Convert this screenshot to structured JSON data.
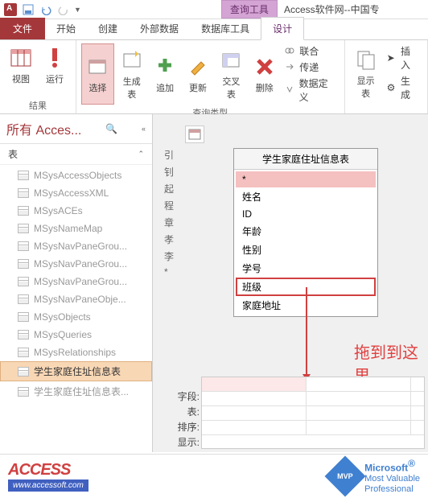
{
  "titlebar": {
    "context_tab": "查询工具",
    "app_title": "Access软件网--中国专"
  },
  "tabs": {
    "file": "文件",
    "start": "开始",
    "create": "创建",
    "external": "外部数据",
    "dbtools": "数据库工具",
    "design": "设计"
  },
  "ribbon": {
    "view": "视图",
    "run": "运行",
    "select": "选择",
    "maketable": "生成表",
    "append": "追加",
    "update": "更新",
    "crosstab": "交叉表",
    "delete": "删除",
    "union": "联合",
    "passthrough": "传递",
    "datadef": "数据定义",
    "showtable": "显示表",
    "insert": "插入",
    "buildrow": "生成",
    "grp_results": "结果",
    "grp_querytype": "查询类型"
  },
  "nav": {
    "title": "所有 Acces...",
    "section": "表",
    "items": [
      "MSysAccessObjects",
      "MSysAccessXML",
      "MSysACEs",
      "MSysNameMap",
      "MSysNavPaneGrou...",
      "MSysNavPaneGrou...",
      "MSysNavPaneGrou...",
      "MSysNavPaneObje...",
      "MSysObjects",
      "MSysQueries",
      "MSysRelationships",
      "学生家庭住址信息表",
      "学生家庭住址信息表..."
    ]
  },
  "fieldbox": {
    "title": "学生家庭住址信息表",
    "fields": [
      "*",
      "姓名",
      "ID",
      "年龄",
      "性别",
      "学号",
      "班级",
      "家庭地址"
    ]
  },
  "sidecol": [
    "引",
    "钊",
    "起",
    "程",
    "章",
    "孝",
    "李"
  ],
  "annotation": "拖到到这里",
  "grid": {
    "labels": [
      "字段:",
      "表:",
      "排序:",
      "显示:"
    ]
  },
  "footer": {
    "brand": "ACCESS",
    "url": "www.accessoft.com",
    "mvp": "MVP",
    "ms": "Microsoft",
    "mv": "Most Valuable",
    "pr": "Professional",
    "reg": "®"
  }
}
